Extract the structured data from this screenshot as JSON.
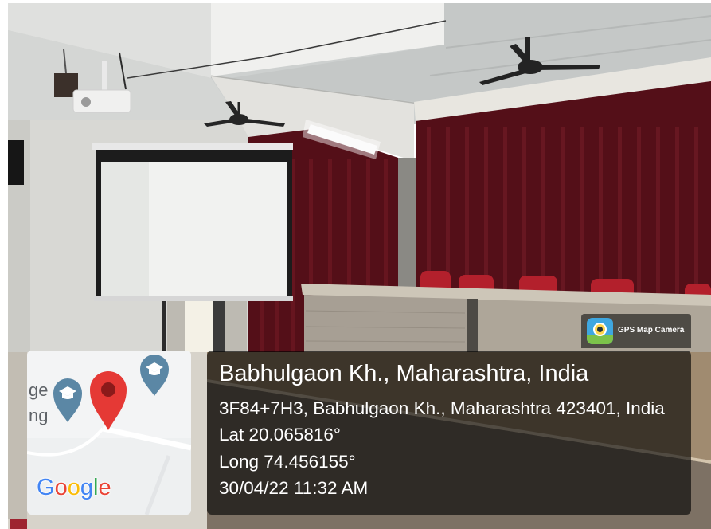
{
  "badge": {
    "label": "GPS Map Camera",
    "icon": "gps-map-camera-app-icon"
  },
  "location": {
    "title": "Babhulgaon Kh., Maharashtra, India",
    "address": "3F84+7H3, Babhulgaon Kh., Maharashtra 423401, India",
    "latitude": "Lat 20.065816°",
    "longitude": "Long 74.456155°",
    "timestamp": "30/04/22 11:32 AM"
  },
  "map": {
    "labels": [
      "ge",
      "ng"
    ],
    "logo": "Google",
    "logo_colors": [
      "#4285F4",
      "#EA4335",
      "#FBBC05",
      "#4285F4",
      "#34A853",
      "#EA4335"
    ],
    "pins": [
      {
        "icon": "location-pin-icon",
        "color": "#E53935"
      },
      {
        "icon": "school-pin-icon",
        "color": "#5B87A5"
      },
      {
        "icon": "school-pin-icon",
        "color": "#5B87A5"
      }
    ]
  },
  "colors": {
    "overlay_background": "#000000",
    "overlay_text": "#FFFFFF",
    "curtain": "#540F18",
    "chair": "#B3202C",
    "screen": "#F1F2F0"
  }
}
